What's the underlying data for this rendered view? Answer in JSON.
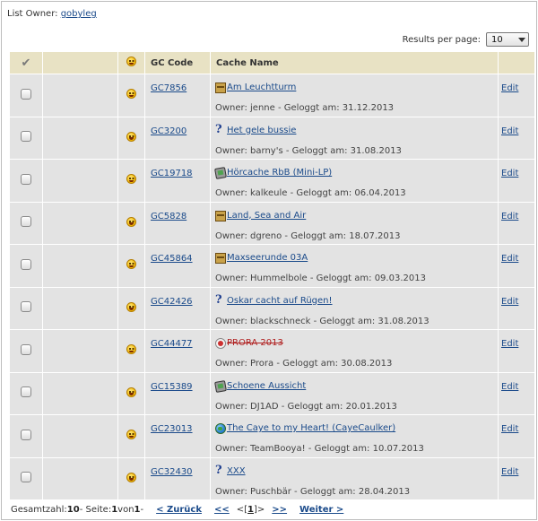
{
  "header": {
    "owner_label": "List Owner: ",
    "owner_name": "gobyleg"
  },
  "results_per_page": {
    "label": "Results per page:",
    "selected": "10"
  },
  "table": {
    "columns": {
      "check": "✔",
      "status": "smiley",
      "gc_code": "GC Code",
      "cache_name": "Cache Name"
    },
    "owner_prefix": "Owner: ",
    "logged_prefix": " - Geloggt am: ",
    "edit_label": "Edit",
    "rows": [
      {
        "code": "GC7856",
        "type_icon": "traditional-cache-icon",
        "name": "Am Leuchtturm",
        "owner": "jenne",
        "date": "31.12.2013",
        "archived": false
      },
      {
        "code": "GC3200",
        "type_icon": "mystery-cache-icon",
        "name": "Het gele bussie",
        "owner": "barny's",
        "date": "31.08.2013",
        "archived": false
      },
      {
        "code": "GC19718",
        "type_icon": "multi-cache-icon",
        "name": "Hörcache RbB (Mini-LP)",
        "owner": "kalkeule",
        "date": "06.04.2013",
        "archived": false
      },
      {
        "code": "GC5828",
        "type_icon": "traditional-cache-icon",
        "name": "Land, Sea and Air",
        "owner": "dgreno",
        "date": "18.07.2013",
        "archived": false
      },
      {
        "code": "GC45864",
        "type_icon": "traditional-cache-icon",
        "name": "Maxseerunde 03A",
        "owner": "Hummelbole",
        "date": "09.03.2013",
        "archived": false
      },
      {
        "code": "GC42426",
        "type_icon": "mystery-cache-icon",
        "name": "Oskar cacht auf Rügen!",
        "owner": "blackschneck",
        "date": "31.08.2013",
        "archived": false
      },
      {
        "code": "GC44477",
        "type_icon": "event-cache-icon",
        "name": "PRORA 2013",
        "owner": "Prora",
        "date": "30.08.2013",
        "archived": true
      },
      {
        "code": "GC15389",
        "type_icon": "multi-cache-icon",
        "name": "Schoene Aussicht",
        "owner": "DJ1AD",
        "date": "20.01.2013",
        "archived": false
      },
      {
        "code": "GC23013",
        "type_icon": "earthcache-icon",
        "name": "The Caye to my Heart! (CayeCaulker)",
        "owner": "TeamBooya!",
        "date": "10.07.2013",
        "archived": false
      },
      {
        "code": "GC32430",
        "type_icon": "mystery-cache-icon",
        "name": "XXX",
        "owner": "Puschbär",
        "date": "28.04.2013",
        "archived": false
      }
    ]
  },
  "footer": {
    "total_label": "Gesamtzahl: ",
    "total": "10",
    "page_label": " - Seite: ",
    "page": "1",
    "of_label": " von ",
    "pages": "1",
    "trailing": " -",
    "prev": "< Zurück",
    "first": "<<",
    "current_open": "<[",
    "current": "1",
    "current_close": "]>",
    "last": ">>",
    "next": "Weiter >"
  }
}
